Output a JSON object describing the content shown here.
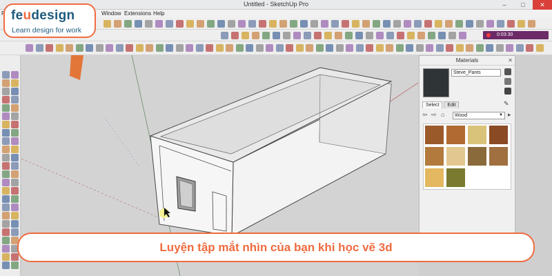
{
  "window": {
    "title": "Untitled - SketchUp Pro",
    "minimize": "–",
    "maximize": "□",
    "close": "✕"
  },
  "menu": {
    "items": [
      "Window",
      "Extensions",
      "Help"
    ],
    "partial_first": "Fi"
  },
  "recorder": {
    "time": "0:03:30"
  },
  "materials": {
    "header": "Materials",
    "close_glyph": "✕",
    "material_name": "Steve_Pants",
    "tabs": [
      "Select",
      "Edit"
    ],
    "library": "Wood",
    "swatch_colors": [
      "#9b5a2a",
      "#b06a32",
      "#d9c27a",
      "#8a4a24",
      "#b27a3c",
      "#e2c890",
      "#8a6a3a",
      "#a07040",
      "#e3b860",
      "#7a7a30"
    ]
  },
  "branding": {
    "brand_prefix": "fe",
    "brand_mid": "u",
    "brand_suffix": "design",
    "tagline": "Learn design for work",
    "accent": "#f06b40",
    "navy": "#1f5a7d"
  },
  "caption": {
    "text": "Luyện tập mắt nhìn của bạn khi học vẽ 3d"
  }
}
